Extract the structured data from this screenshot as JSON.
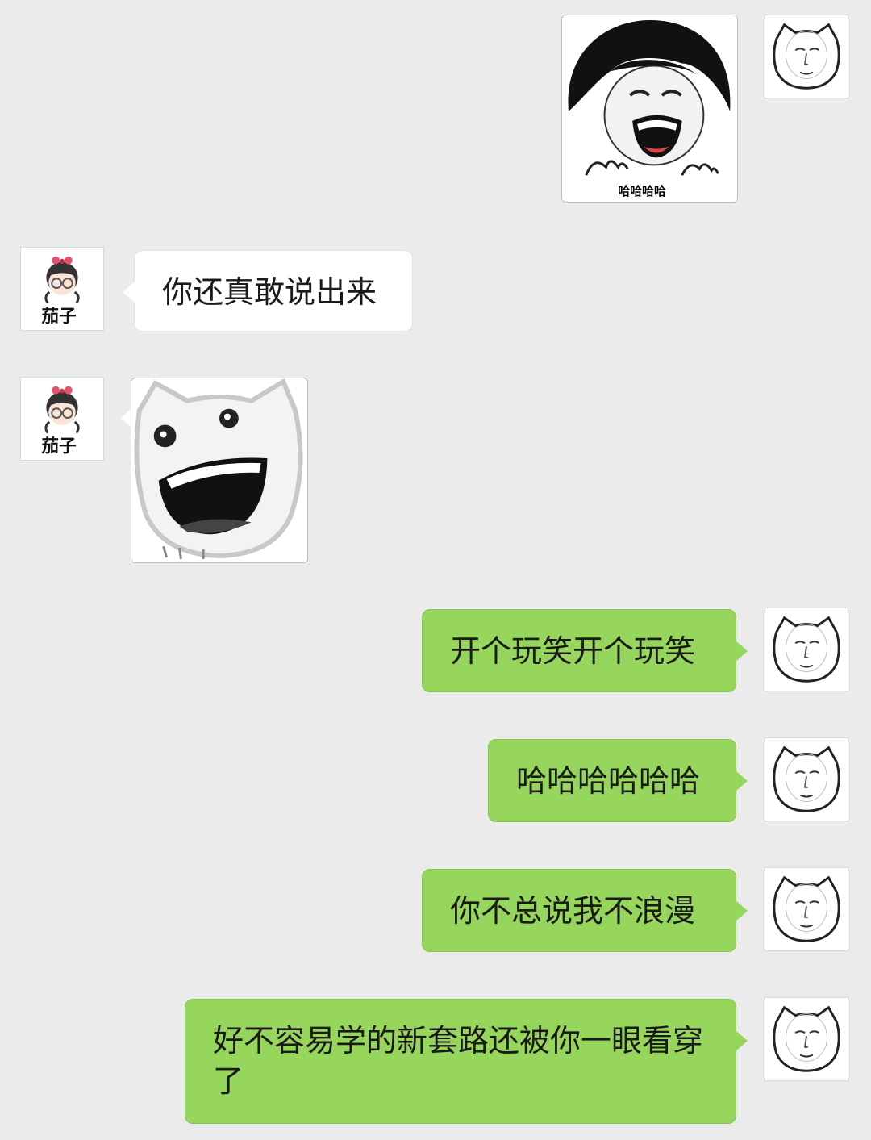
{
  "colors": {
    "background": "#ebebeb",
    "my_bubble": "#96d65d",
    "other_bubble": "#ffffff"
  },
  "contacts": {
    "other": {
      "name_on_avatar": "茄子",
      "avatar_icon": "girl-with-glasses-avatar-icon"
    },
    "me": {
      "avatar_icon": "cat-face-man-avatar-icon"
    }
  },
  "messages": [
    {
      "sender": "me",
      "type": "sticker",
      "sticker_icon": "bowl-cut-laughing-face-sticker-icon",
      "caption": "哈哈哈哈"
    },
    {
      "sender": "other",
      "type": "text",
      "text": "你还真敢说出来"
    },
    {
      "sender": "other",
      "type": "sticker",
      "sticker_icon": "grinning-cat-face-sticker-icon"
    },
    {
      "sender": "me",
      "type": "text",
      "text": "开个玩笑开个玩笑"
    },
    {
      "sender": "me",
      "type": "text",
      "text": "哈哈哈哈哈哈"
    },
    {
      "sender": "me",
      "type": "text",
      "text": "你不总说我不浪漫"
    },
    {
      "sender": "me",
      "type": "text",
      "text": "好不容易学的新套路还被你一眼看穿了"
    }
  ]
}
